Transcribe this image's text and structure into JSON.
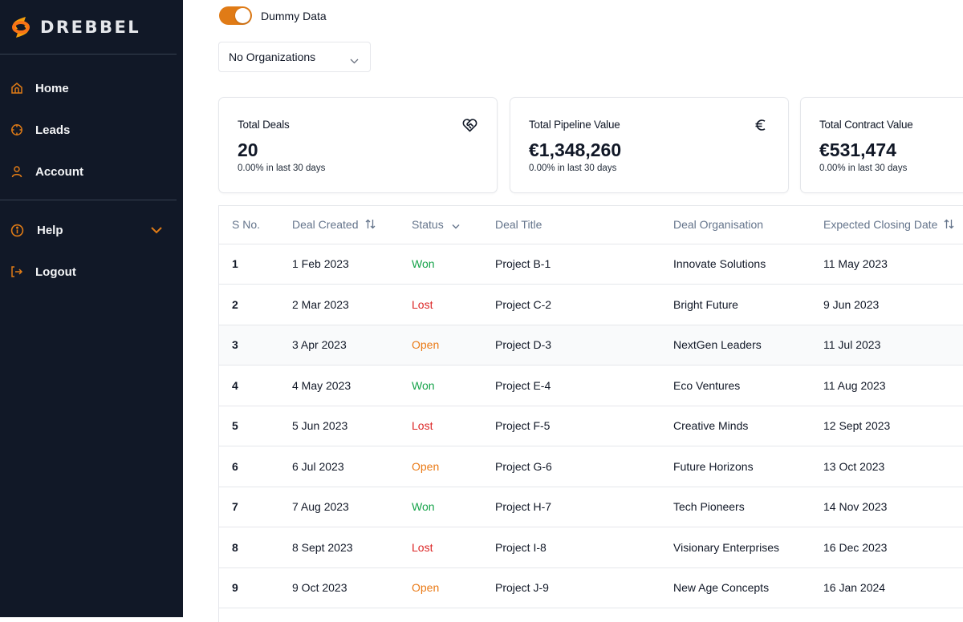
{
  "brand": {
    "name": "DREBBEL",
    "logo_icon": "swirl-logo-icon"
  },
  "sidebar": {
    "items": [
      {
        "label": "Home",
        "icon": "home-icon"
      },
      {
        "label": "Leads",
        "icon": "crosshair-icon"
      },
      {
        "label": "Account",
        "icon": "user-icon"
      },
      {
        "label": "Help",
        "icon": "info-icon",
        "expandable": true
      },
      {
        "label": "Logout",
        "icon": "logout-icon"
      }
    ]
  },
  "controls": {
    "toggle_label": "Dummy Data",
    "toggle_on": true,
    "organization_select": "No Organizations"
  },
  "cards": [
    {
      "title": "Total Deals",
      "value": "20",
      "sub": "0.00% in last 30 days",
      "icon": "handshake-heart-icon"
    },
    {
      "title": "Total Pipeline Value",
      "value": "€1,348,260",
      "sub": "0.00% in last 30 days",
      "icon": "euro-icon"
    },
    {
      "title": "Total Contract Value",
      "value": "€531,474",
      "sub": "0.00% in last 30 days",
      "icon": ""
    }
  ],
  "table": {
    "columns": [
      {
        "label": "S No.",
        "icon": ""
      },
      {
        "label": "Deal Created",
        "icon": "sort-icon"
      },
      {
        "label": "Status",
        "icon": "chevron-down-icon"
      },
      {
        "label": "Deal Title",
        "icon": ""
      },
      {
        "label": "Deal Organisation",
        "icon": ""
      },
      {
        "label": "Expected Closing Date",
        "icon": "sort-icon"
      }
    ],
    "rows": [
      {
        "sno": "1",
        "created": "1 Feb 2023",
        "status": "Won",
        "title": "Project B-1",
        "org": "Innovate Solutions",
        "closing": "11 May 2023"
      },
      {
        "sno": "2",
        "created": "2 Mar 2023",
        "status": "Lost",
        "title": "Project C-2",
        "org": "Bright Future",
        "closing": "9 Jun 2023"
      },
      {
        "sno": "3",
        "created": "3 Apr 2023",
        "status": "Open",
        "title": "Project D-3",
        "org": "NextGen Leaders",
        "closing": "11 Jul 2023"
      },
      {
        "sno": "4",
        "created": "4 May 2023",
        "status": "Won",
        "title": "Project E-4",
        "org": "Eco Ventures",
        "closing": "11 Aug 2023"
      },
      {
        "sno": "5",
        "created": "5 Jun 2023",
        "status": "Lost",
        "title": "Project F-5",
        "org": "Creative Minds",
        "closing": "12 Sept 2023"
      },
      {
        "sno": "6",
        "created": "6 Jul 2023",
        "status": "Open",
        "title": "Project G-6",
        "org": "Future Horizons",
        "closing": "13 Oct 2023"
      },
      {
        "sno": "7",
        "created": "7 Aug 2023",
        "status": "Won",
        "title": "Project H-7",
        "org": "Tech Pioneers",
        "closing": "14 Nov 2023"
      },
      {
        "sno": "8",
        "created": "8 Sept 2023",
        "status": "Lost",
        "title": "Project I-8",
        "org": "Visionary Enterprises",
        "closing": "16 Dec 2023"
      },
      {
        "sno": "9",
        "created": "9 Oct 2023",
        "status": "Open",
        "title": "Project J-9",
        "org": "New Age Concepts",
        "closing": "16 Jan 2024"
      }
    ]
  },
  "colors": {
    "sidebar_bg": "#111827",
    "accent": "#e07b16",
    "won": "#16a34a",
    "lost": "#dc2626",
    "open": "#ea7a16"
  }
}
